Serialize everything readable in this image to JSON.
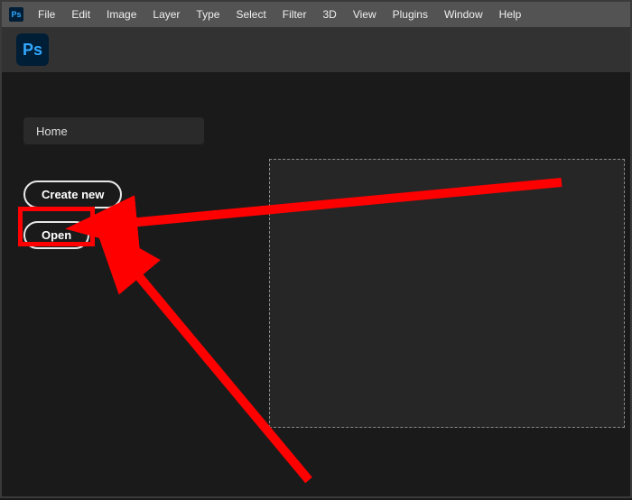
{
  "app": {
    "short_name": "Ps"
  },
  "menubar": {
    "items": [
      "File",
      "Edit",
      "Image",
      "Layer",
      "Type",
      "Select",
      "Filter",
      "3D",
      "View",
      "Plugins",
      "Window",
      "Help"
    ]
  },
  "home": {
    "tab_label": "Home",
    "create_new_label": "Create new",
    "open_label": "Open"
  },
  "annotation": {
    "highlight_target": "open-button",
    "arrow_color": "#ff0000"
  }
}
